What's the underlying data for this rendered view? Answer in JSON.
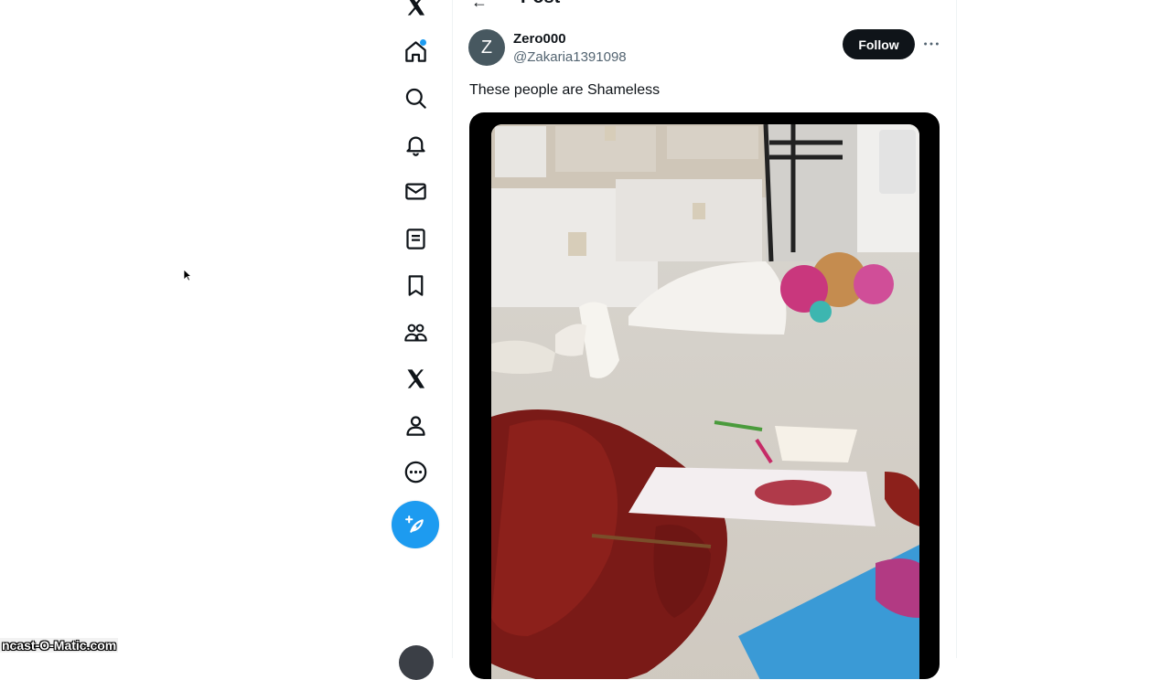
{
  "nav": {
    "items": [
      {
        "icon": "x-logo-icon"
      },
      {
        "icon": "home-icon",
        "has_notification_dot": true
      },
      {
        "icon": "search-icon"
      },
      {
        "icon": "bell-icon"
      },
      {
        "icon": "mail-icon"
      },
      {
        "icon": "list-icon"
      },
      {
        "icon": "bookmark-icon"
      },
      {
        "icon": "communities-icon"
      },
      {
        "icon": "x-premium-icon"
      },
      {
        "icon": "profile-icon"
      },
      {
        "icon": "more-circle-icon"
      }
    ],
    "compose_icon": "feather-plus-icon",
    "accent": "#1d9bf0"
  },
  "header": {
    "back_icon": "arrow-left-icon",
    "title": "Post"
  },
  "tweet": {
    "avatar_letter": "Z",
    "avatar_color": "#475860",
    "name": "Zero000",
    "handle": "@Zakaria1391098",
    "follow_label": "Follow",
    "more_icon": "more-horizontal-icon",
    "text": "These people are Shameless",
    "media_icon": "photo"
  },
  "watermark": "ncast-O-Matic.com"
}
